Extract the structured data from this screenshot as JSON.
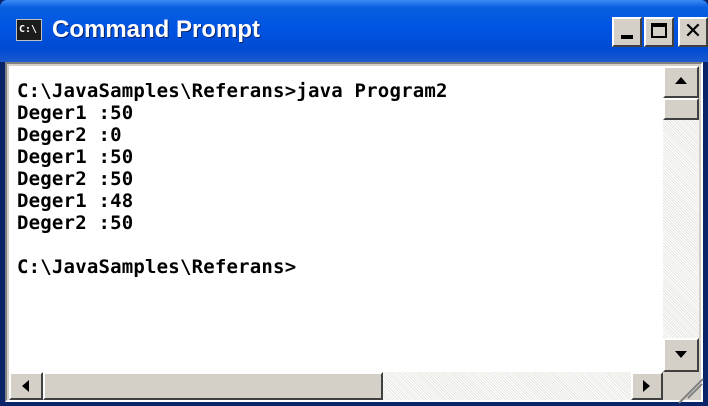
{
  "window": {
    "title": "Command Prompt",
    "icon": "cmd-icon",
    "icon_text": "C:\\",
    "controls": {
      "minimize_icon": "minimize-icon",
      "maximize_icon": "maximize-icon",
      "close_icon": "close-icon",
      "close_glyph": "✕"
    },
    "colors": {
      "titlebar": "#0054e3",
      "console_background": "#ffffff",
      "console_text": "#000000",
      "chrome": "#d4d0c8"
    }
  },
  "console": {
    "lines": [
      "C:\\JavaSamples\\Referans>java Program2",
      "Deger1 :50",
      "Deger2 :0",
      "Deger1 :50",
      "Deger2 :50",
      "Deger1 :48",
      "Deger2 :50",
      "",
      "C:\\JavaSamples\\Referans>"
    ]
  },
  "scrollbars": {
    "vertical": {
      "up_icon": "arrow-up-icon",
      "down_icon": "arrow-down-icon"
    },
    "horizontal": {
      "left_icon": "arrow-left-icon",
      "right_icon": "arrow-right-icon"
    }
  }
}
